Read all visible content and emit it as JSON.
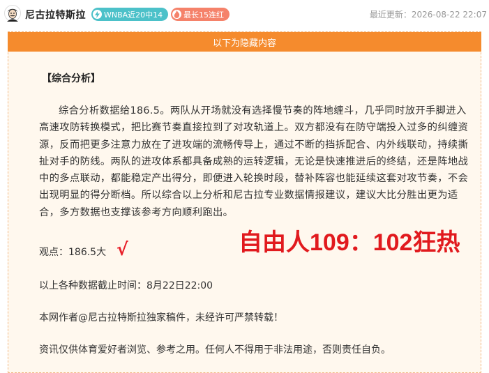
{
  "header": {
    "author_name": "尼古拉特斯拉",
    "badges": [
      {
        "icon": "bolt-icon",
        "label": "WNBA近20中14",
        "color": "#4cc1c9"
      },
      {
        "icon": "flame-icon",
        "label": "最长15连红",
        "color": "#f5826a"
      }
    ],
    "update_time": "最近更新：2026-08-22 22:07"
  },
  "content": {
    "hidden_banner": "以下为隐藏内容",
    "section_title": "【综合分析】",
    "analysis": "综合分析数据给186.5。两队从开场就没有选择慢节奏的阵地缠斗，几乎同时放开手脚进入高速攻防转换模式，把比赛节奏直接拉到了对攻轨道上。双方都没有在防守端投入过多的纠缠资源，反而把更多注意力放在了进攻端的流畅传导上，通过不断的挡拆配合、内外线联动，持续撕扯对手的防线。两队的进攻体系都具备成熟的运转逻辑，无论是快速推进后的终结，还是阵地战中的多点联动，都能稳定产出得分，即便进入轮换时段，替补阵容也能延续这套对攻节奏，不会出现明显的得分断档。所以综合以上分析和尼古拉专业数据情报建议，建议大比分胜出更为适合，多方数据也支撑该参考方向顺利跑出。",
    "opinion": "观点：186.5大",
    "checkmark": "√",
    "promo_score": "自由人109：102狂热",
    "data_cutoff": "以上各种数据截止时间：8月22日22:00",
    "copyright": "本网作者@尼古拉特斯拉独家稿件，未经许可严禁转载！",
    "disclaimer": "资讯仅供体育爱好者浏览、参考之用。任何人不得用于非法用途，否则责任自负。"
  },
  "colors": {
    "accent_orange": "#f58b2d",
    "card_background": "#fff8ee",
    "promo_red": "#e11a1e"
  }
}
